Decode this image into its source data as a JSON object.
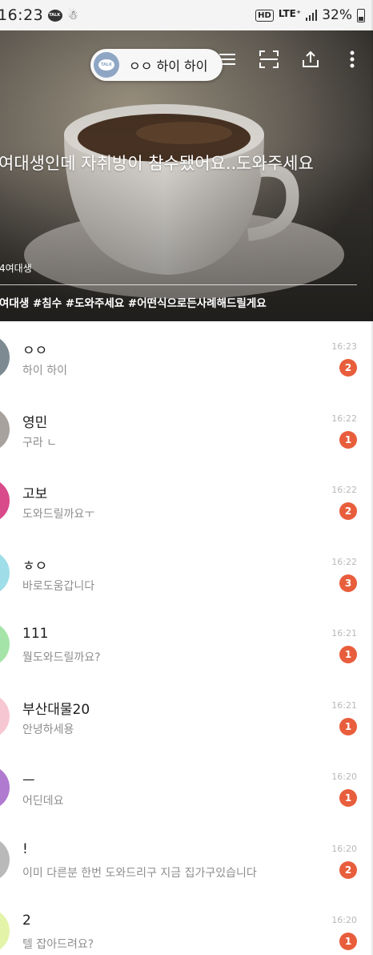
{
  "status_bar": {
    "time": "16:23",
    "network_hd": "HD",
    "network_type": "LTE⁺",
    "battery": "32%"
  },
  "notification": {
    "text": "ㅇㅇ 하이 하이",
    "app_icon_label": "TALK"
  },
  "cover": {
    "title": "여대생인데 자취방이 참수됐어요..도와주세요",
    "owner": "4여대생",
    "tags": "여대생 #침수 #도와주세요 #어떤식으로든사례해드릴게요"
  },
  "colors": {
    "badge": "#e85e3c",
    "toast_icon": "#8ea6c4"
  },
  "chats": [
    {
      "name": "ㅇㅇ",
      "preview": "하이 하이",
      "time": "16:23",
      "unread": "2",
      "avatar_color": "#7d8a92"
    },
    {
      "name": "영민",
      "preview": "구라 ㄴ",
      "time": "16:22",
      "unread": "1",
      "avatar_color": "#a7a29d"
    },
    {
      "name": "고보",
      "preview": "도와드릴까요ㅜ",
      "time": "16:22",
      "unread": "2",
      "avatar_color": "#d84a8a"
    },
    {
      "name": "ㅎㅇ",
      "preview": "바로도움갑니다",
      "time": "16:22",
      "unread": "3",
      "avatar_color": "#9fdde8"
    },
    {
      "name": "111",
      "preview": "뭘도와드릴까요?",
      "time": "16:21",
      "unread": "1",
      "avatar_color": "#a5e4a8"
    },
    {
      "name": "부산대물20",
      "preview": "안녕하세용",
      "time": "16:21",
      "unread": "1",
      "avatar_color": "#f7c6d3"
    },
    {
      "name": "ㅡ",
      "preview": "어딘데요",
      "time": "16:20",
      "unread": "1",
      "avatar_color": "#b07ad0"
    },
    {
      "name": "!",
      "preview": "이미 다른분 한번 도와드리구 지금 집가구있습니다",
      "time": "16:20",
      "unread": "2",
      "avatar_color": "#b9b9b9"
    },
    {
      "name": "2",
      "preview": "텔 잡아드려요?",
      "time": "16:20",
      "unread": "1",
      "avatar_color": "#e3f3a8"
    }
  ]
}
